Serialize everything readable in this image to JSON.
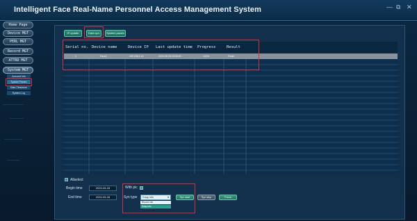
{
  "app": {
    "title": "Intelligent Face Real-Name Personnel Access Management System",
    "minimize": "—",
    "restore": "⧉",
    "close": "✕"
  },
  "sidebar": {
    "items": [
      {
        "label": "Home Page"
      },
      {
        "label": "Device MGT"
      },
      {
        "label": "PERL MGT"
      },
      {
        "label": "Record MGT"
      },
      {
        "label": "ATTRD MGT"
      },
      {
        "label": "System MGT"
      }
    ],
    "sub_items": [
      {
        "label": "Account Info"
      },
      {
        "label": "System Param"
      },
      {
        "label": "Data Clearance"
      },
      {
        "label": "System Log"
      }
    ]
  },
  "toolbar": {
    "ip_update": "IP update",
    "data_sync": "Data syn",
    "system_param": "System param"
  },
  "table": {
    "columns": [
      "Serial no.",
      "Device name",
      "Device IP",
      "Last update time",
      "Progress",
      "Result"
    ],
    "rows": [
      [
        "1",
        "Face1",
        "192.168.1.10",
        "2020-05-28 15:00:00",
        "100%",
        "Finish"
      ]
    ]
  },
  "footer": {
    "allselect": "Allselect",
    "begin_time_label": "Begin time",
    "begin_time_value": "2020-05-28",
    "end_time_label": "End time",
    "end_time_value": "2020-05-28",
    "with_pic_label": "With pic",
    "syn_type_label": "Syn type",
    "syn_type_value": "Snap info",
    "syn_type_options": [
      "Record info",
      "Snap info"
    ],
    "syn_start": "Syc start",
    "syn_stop": "Syc stop",
    "fresh": "Fresh"
  }
}
